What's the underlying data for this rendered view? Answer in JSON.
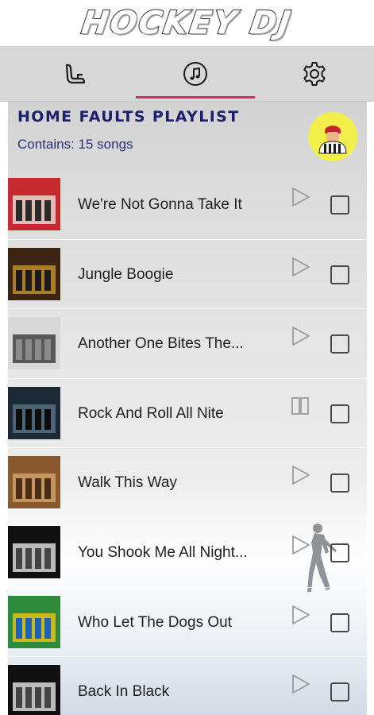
{
  "app": {
    "title": "HOCKEY DJ"
  },
  "tabs": [
    {
      "icon": "seat-icon",
      "active": false
    },
    {
      "icon": "music-note-icon",
      "active": true
    },
    {
      "icon": "gear-icon",
      "active": false
    }
  ],
  "colors": {
    "accent": "#e0295c",
    "title": "#1c1e6e",
    "tab_bar": "#d7d7d7",
    "avatar_bg": "#f3ef4a"
  },
  "playlist": {
    "title": "HOME FAULTS PLAYLIST",
    "count_text": "Contains: 15 songs",
    "songs": [
      {
        "title": "We're Not Gonna Take It",
        "state": "play",
        "selected": false,
        "art_colors": [
          "#c62a2f",
          "#e8e0d6",
          "#2a2a2a"
        ]
      },
      {
        "title": "Jungle Boogie",
        "state": "play",
        "selected": false,
        "art_colors": [
          "#3b2412",
          "#c99234",
          "#1a1a1a"
        ]
      },
      {
        "title": "Another One Bites The...",
        "state": "play",
        "selected": false,
        "art_colors": [
          "#d8d8d8",
          "#3a3a3a",
          "#8a8a8a"
        ]
      },
      {
        "title": "Rock And Roll All Nite",
        "state": "pause",
        "selected": false,
        "art_colors": [
          "#1c2a36",
          "#5a7384",
          "#0c0c0c"
        ]
      },
      {
        "title": "Walk This Way",
        "state": "play",
        "selected": false,
        "art_colors": [
          "#8a5a2e",
          "#cfa56a",
          "#4a2d14"
        ]
      },
      {
        "title": "You Shook Me All Night...",
        "state": "play",
        "selected": false,
        "art_colors": [
          "#111111",
          "#e6e6e6",
          "#444444"
        ]
      },
      {
        "title": "Who Let The Dogs Out",
        "state": "play",
        "selected": false,
        "art_colors": [
          "#2f8a3a",
          "#f0c419",
          "#1c63b8"
        ]
      },
      {
        "title": "Back In Black",
        "state": "play",
        "selected": false,
        "art_colors": [
          "#111111",
          "#e6e6e6",
          "#444444"
        ]
      }
    ]
  }
}
